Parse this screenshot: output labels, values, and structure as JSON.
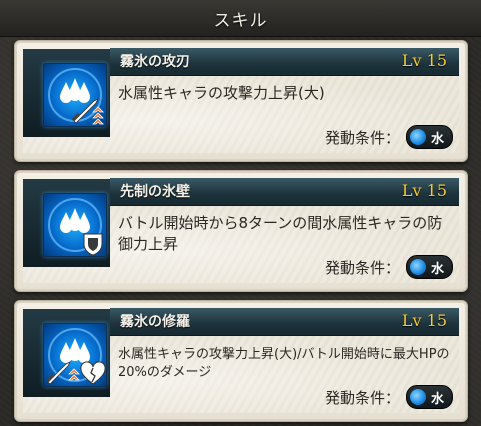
{
  "header": {
    "title": "スキル"
  },
  "skills": [
    {
      "name": "霧氷の攻刃",
      "level": "Lv 15",
      "description": "水属性キャラの攻撃力上昇(大)",
      "condition_label": "発動条件：",
      "element": "水",
      "badges": [
        "sword-icon",
        "up-arrows-icon"
      ]
    },
    {
      "name": "先制の氷壁",
      "level": "Lv 15",
      "description": "バトル開始時から8ターンの間水属性キャラの防御力上昇",
      "condition_label": "発動条件：",
      "element": "水",
      "badges": [
        "shield-icon"
      ]
    },
    {
      "name": "霧氷の修羅",
      "level": "Lv 15",
      "description": "水属性キャラの攻撃力上昇(大)/バトル開始時に最大HPの20%のダメージ",
      "condition_label": "発動条件：",
      "element": "水",
      "badges": [
        "sword-icon",
        "up-arrows-icon",
        "broken-heart-icon"
      ]
    }
  ],
  "colors": {
    "level_text": "#f2cc3a",
    "icon_blue": "#0567c9",
    "titlebar": "#1d323b"
  }
}
